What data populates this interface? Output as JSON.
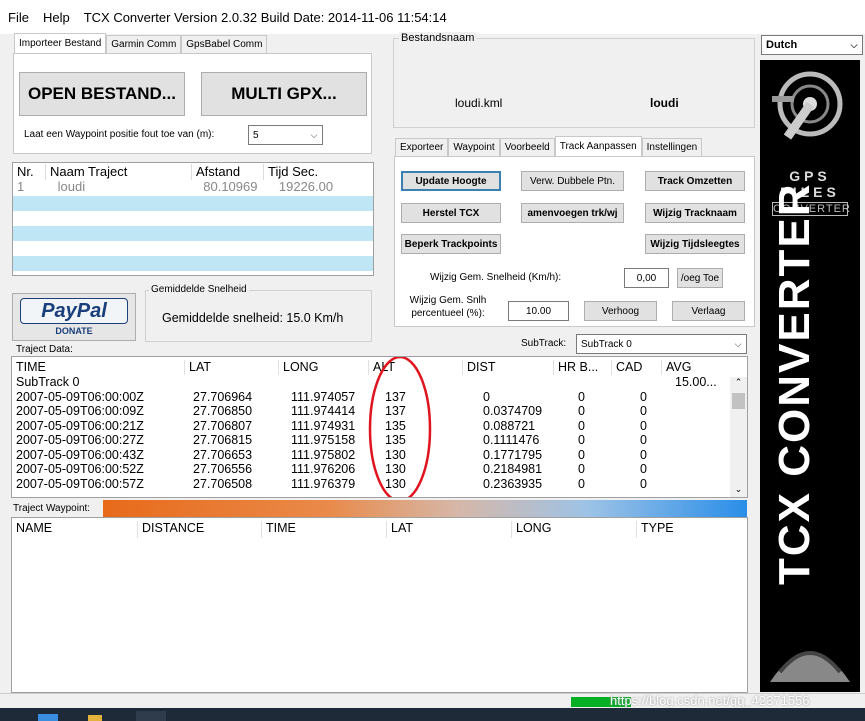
{
  "menu": {
    "file": "File",
    "help": "Help",
    "title": "TCX Converter Version 2.0.32 Build Date: 2014-11-06 11:54:14"
  },
  "left_tabs": [
    "Importeer Bestand",
    "Garmin Comm",
    "GpsBabel Comm"
  ],
  "open_button": "OPEN BESTAND...",
  "multi_gpx_button": "MULTI GPX...",
  "waypoint_tolerance": {
    "label": "Laat een Waypoint positie fout toe van (m):",
    "value": "5"
  },
  "bestandsnaam": {
    "legend": "Bestandsnaam",
    "file": "loudi.kml",
    "name": "loudi"
  },
  "language": "Dutch",
  "right_tabs": [
    "Exporteer",
    "Waypoint",
    "Voorbeeld",
    "Track Aanpassen",
    "Instellingen"
  ],
  "track_buttons": {
    "update_hoogte": "Update Hoogte",
    "verw_dubbele": "Verw. Dubbele  Ptn.",
    "track_omzetten": "Track Omzetten",
    "herstel_tcx": "Herstel TCX",
    "samenvoegen": "amenvoegen trk/wj",
    "wijzig_tracknaam": "Wijzig Tracknaam",
    "beperk_trackpoints": "Beperk Trackpoints",
    "wijzig_tijdsleegtes": "Wijzig Tijdsleegtes"
  },
  "speed": {
    "label": "Wijzig Gem. Snelheid (Km/h):",
    "value": "0,00",
    "button": "/oeg Toe"
  },
  "speed_pct": {
    "label1": "Wijzig Gem. Snlh",
    "label2": "percentueel (%):",
    "value": "10.00",
    "verhoog": "Verhoog",
    "verlaag": "Verlaag"
  },
  "subtrack": {
    "label": "SubTrack:",
    "value": "SubTrack 0"
  },
  "track_list": {
    "headers": [
      "Nr.",
      "Naam Traject",
      "Afstand",
      "Tijd Sec."
    ],
    "rows": [
      [
        "1",
        "loudi",
        "80.10969",
        "19226.00"
      ]
    ]
  },
  "avg_speed": {
    "legend": "Gemiddelde Snelheid",
    "text": "Gemiddelde snelheid: 15.0 Km/h"
  },
  "paypal": {
    "name": "PayPal",
    "donate": "DONATE"
  },
  "traject_data": {
    "label": "Traject Data:",
    "headers": [
      "TIME",
      "LAT",
      "LONG",
      "ALT",
      "DIST",
      "HR B...",
      "CAD",
      "AVG"
    ],
    "group": "SubTrack 0",
    "group_avg": "15.00...",
    "rows": [
      [
        "2007-05-09T06:00:00Z",
        "27.706964",
        "111.974057",
        "137",
        "0",
        "0",
        "0"
      ],
      [
        "2007-05-09T06:00:09Z",
        "27.706850",
        "111.974414",
        "137",
        "0.0374709",
        "0",
        "0"
      ],
      [
        "2007-05-09T06:00:21Z",
        "27.706807",
        "111.974931",
        "135",
        "0.088721",
        "0",
        "0"
      ],
      [
        "2007-05-09T06:00:27Z",
        "27.706815",
        "111.975158",
        "135",
        "0.1111476",
        "0",
        "0"
      ],
      [
        "2007-05-09T06:00:43Z",
        "27.706653",
        "111.975802",
        "130",
        "0.1771795",
        "0",
        "0"
      ],
      [
        "2007-05-09T06:00:52Z",
        "27.706556",
        "111.976206",
        "130",
        "0.2184981",
        "0",
        "0"
      ],
      [
        "2007-05-09T06:00:57Z",
        "27.706508",
        "111.976379",
        "130",
        "0.2363935",
        "0",
        "0"
      ]
    ]
  },
  "traject_waypoint": {
    "label": "Traject Waypoint:",
    "headers": [
      "NAME",
      "DISTANCE",
      "TIME",
      "LAT",
      "LONG",
      "TYPE"
    ]
  },
  "logo": {
    "gps": "GPS",
    "files": "FILES",
    "converter": "CONVERTER",
    "vertical": "TCX CONVERTER"
  },
  "watermark": "https://blog.csdn.net/qq_42371556",
  "colors": {
    "annotation": "#e0141e",
    "row_stripe": "#bfe6f5",
    "logo_bg": "#000000"
  }
}
